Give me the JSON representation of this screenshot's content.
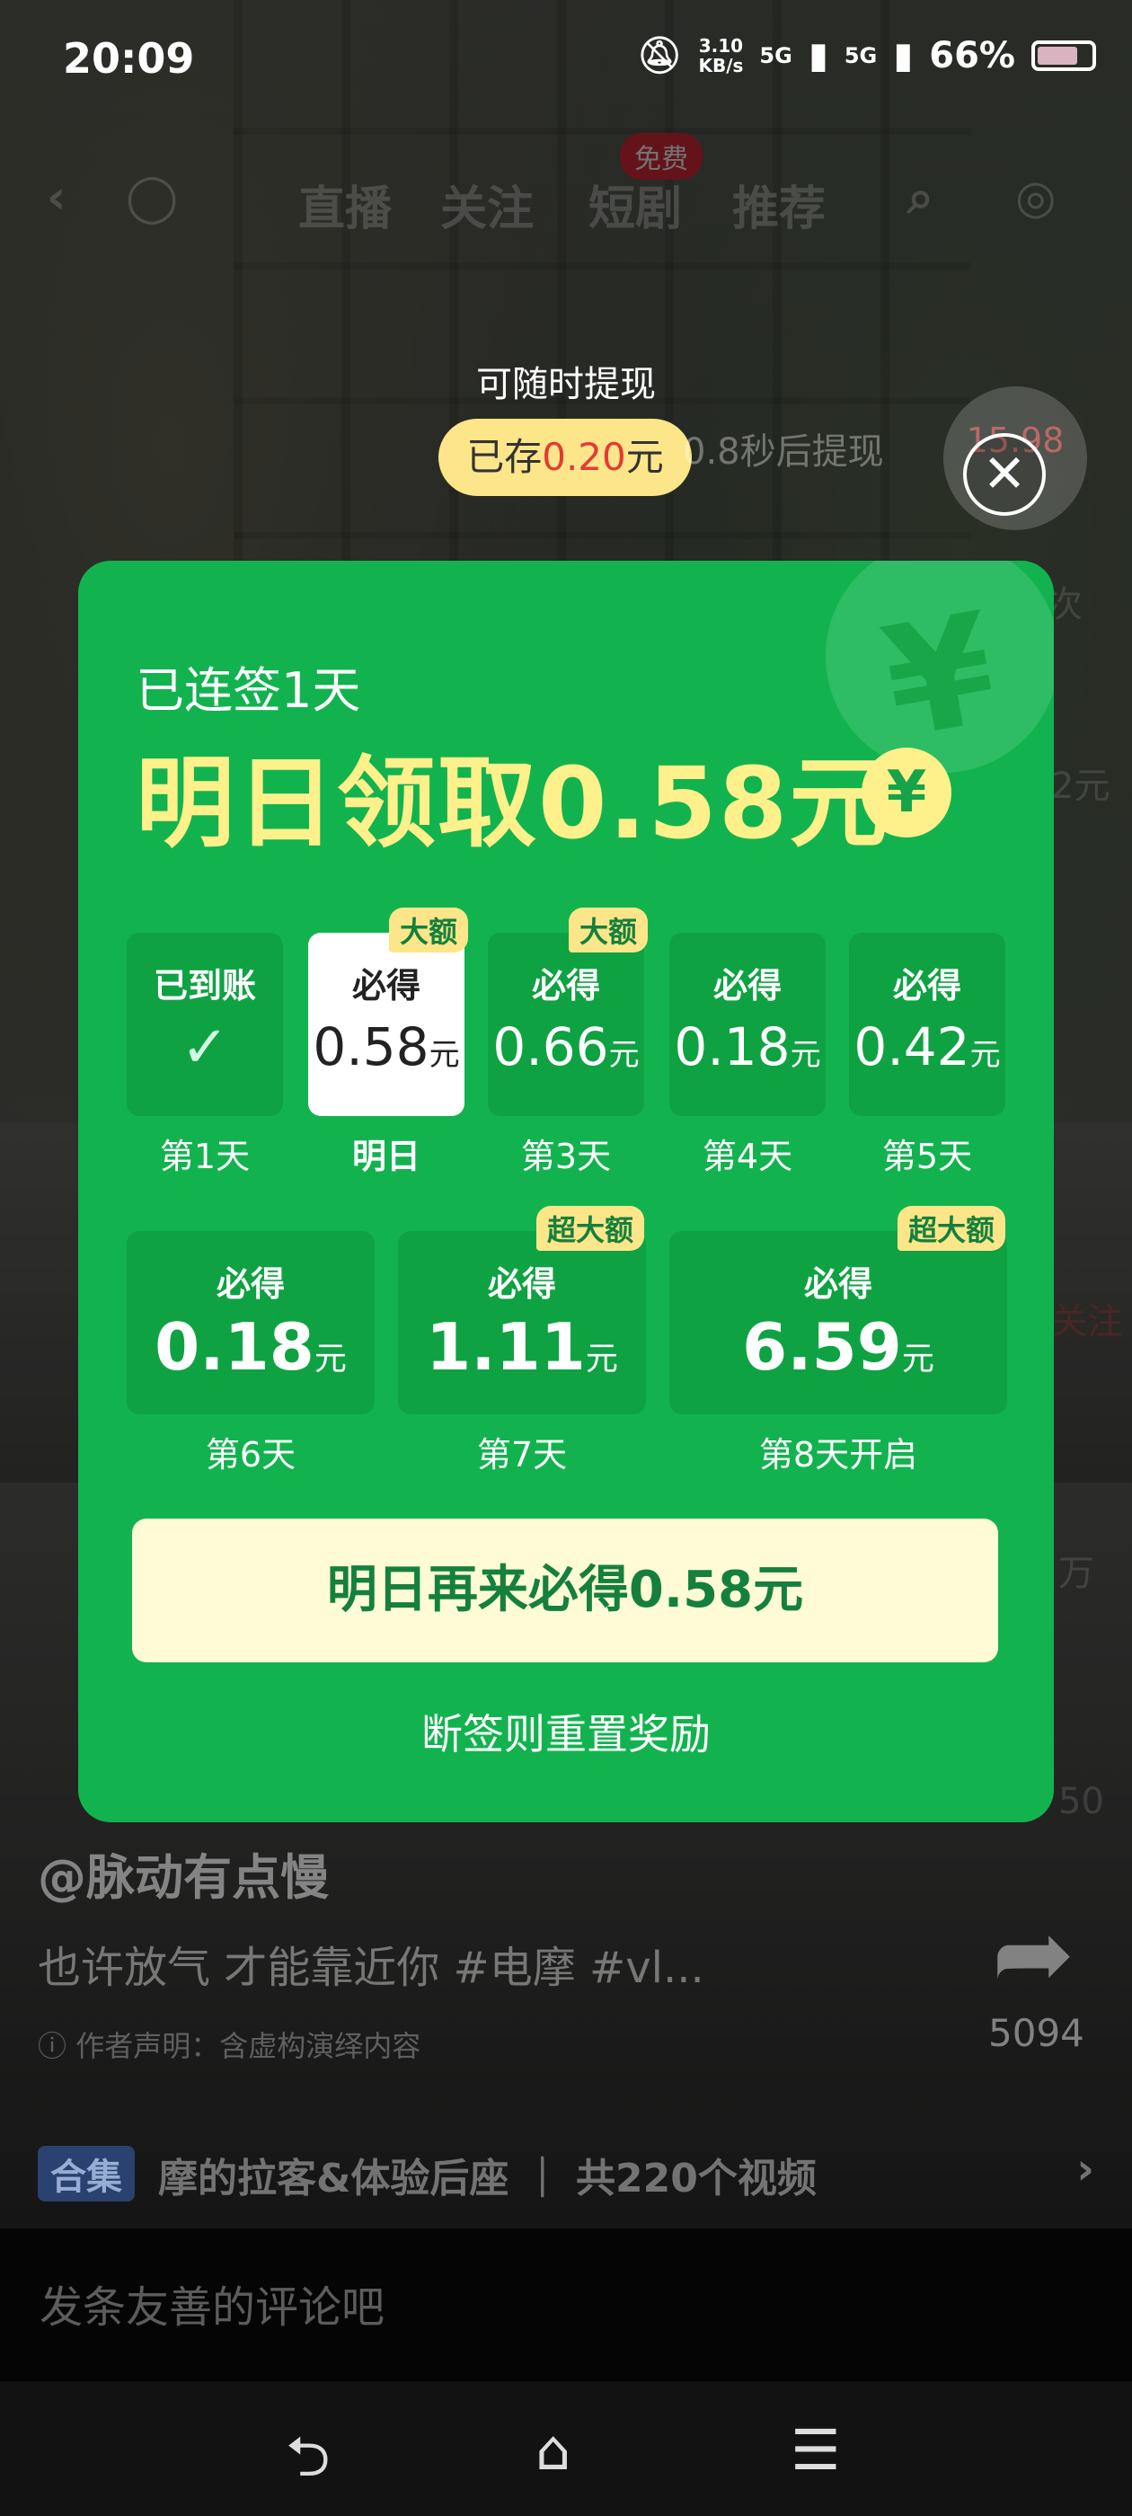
{
  "status": {
    "time": "20:09",
    "speed_top": "3.10",
    "speed_bottom": "KB/s",
    "net1": "5G",
    "net2": "5G",
    "battery": "66%"
  },
  "nav": {
    "tabs": [
      "直播",
      "关注",
      "短剧",
      "推荐"
    ],
    "free_badge": "免费"
  },
  "reward": {
    "tip": "可随时提现",
    "saved_prefix": "已存",
    "saved_amount": "0.20",
    "saved_suffix": "元",
    "withdraw_hint": "0.8秒后提现",
    "timer": "15.98"
  },
  "card": {
    "streak": "已连签1天",
    "headline": "明日领取0.58元",
    "yen": "¥",
    "days": [
      {
        "tag": "已到账",
        "value": "",
        "unit": "",
        "label": "第1天",
        "badge": ""
      },
      {
        "tag": "必得",
        "value": "0.58",
        "unit": "元",
        "label": "明日",
        "badge": "大额"
      },
      {
        "tag": "必得",
        "value": "0.66",
        "unit": "元",
        "label": "第3天",
        "badge": "大额"
      },
      {
        "tag": "必得",
        "value": "0.18",
        "unit": "元",
        "label": "第4天",
        "badge": ""
      },
      {
        "tag": "必得",
        "value": "0.42",
        "unit": "元",
        "label": "第5天",
        "badge": ""
      },
      {
        "tag": "必得",
        "value": "0.18",
        "unit": "元",
        "label": "第6天",
        "badge": ""
      },
      {
        "tag": "必得",
        "value": "1.11",
        "unit": "元",
        "label": "第7天",
        "badge": "超大额"
      },
      {
        "tag": "必得",
        "value": "6.59",
        "unit": "元",
        "label": "第8天开启",
        "badge": "超大额"
      }
    ],
    "cta": "明日再来必得0.58元",
    "reset_note": "断签则重置奖励"
  },
  "video": {
    "author": "@脉动有点慢",
    "caption": "也许放气 才能靠近你 #电摩 #vl...",
    "declaration": "作者声明：含虚构演绎内容",
    "share_count": "5094",
    "side_count_1": "万",
    "side_count_2": "50",
    "follow": "关注",
    "side_text_1": "2元",
    "collection_tag": "合集",
    "collection_title": "摩的拉客&体验后座",
    "collection_count": "共220个视频"
  },
  "comment": {
    "placeholder": "发条友善的评论吧"
  },
  "colors": {
    "card_green": "#12b34f",
    "headline_yellow": "#fef08a",
    "cta_bg": "#fffbd6",
    "amount_red": "#e53935"
  }
}
